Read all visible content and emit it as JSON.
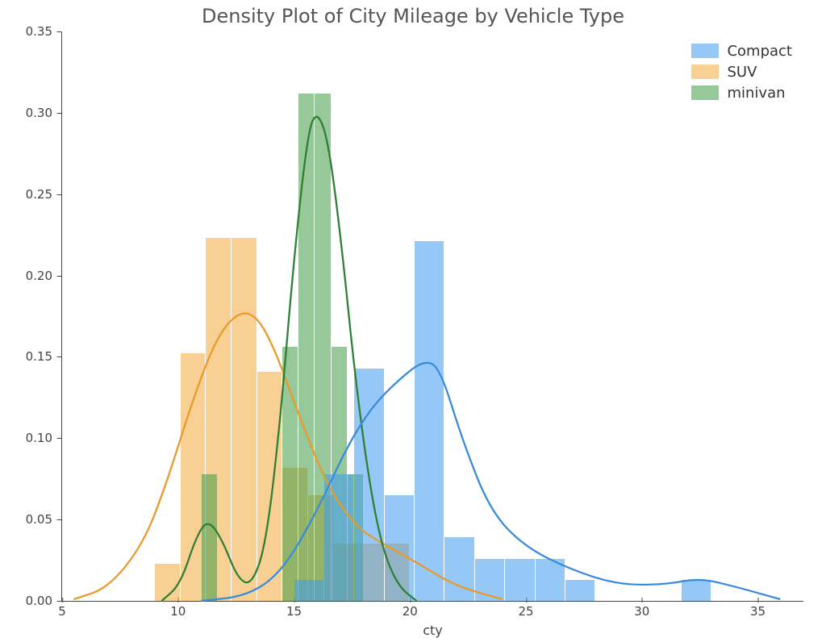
{
  "chart_data": {
    "type": "histogram+kde",
    "title": "Density Plot of City Mileage by Vehicle Type",
    "xlabel": "cty",
    "ylabel": "",
    "xlim": [
      5,
      37
    ],
    "ylim": [
      0,
      0.35
    ],
    "xticks": [
      5,
      10,
      15,
      20,
      25,
      30,
      35
    ],
    "yticks": [
      0.0,
      0.05,
      0.1,
      0.15,
      0.2,
      0.25,
      0.3,
      0.35
    ],
    "colors": {
      "Compact": "#3e9bf0",
      "SUV": "#f2a93b",
      "minivan": "#3f9b47"
    },
    "legend": [
      "Compact",
      "SUV",
      "minivan"
    ],
    "series": [
      {
        "name": "Compact",
        "bars": [
          {
            "x0": 15.0,
            "x1": 16.3,
            "y": 0.013
          },
          {
            "x0": 16.3,
            "x1": 17.6,
            "y": 0.078
          },
          {
            "x0": 17.6,
            "x1": 18.9,
            "y": 0.143
          },
          {
            "x0": 18.9,
            "x1": 20.2,
            "y": 0.065
          },
          {
            "x0": 20.2,
            "x1": 21.5,
            "y": 0.221
          },
          {
            "x0": 21.5,
            "x1": 22.8,
            "y": 0.039
          },
          {
            "x0": 22.8,
            "x1": 24.1,
            "y": 0.026
          },
          {
            "x0": 24.1,
            "x1": 25.4,
            "y": 0.026
          },
          {
            "x0": 25.4,
            "x1": 26.7,
            "y": 0.026
          },
          {
            "x0": 26.7,
            "x1": 28.0,
            "y": 0.013
          },
          {
            "x0": 31.7,
            "x1": 33.0,
            "y": 0.013
          }
        ],
        "kde": [
          {
            "x": 11.0,
            "y": 0.0
          },
          {
            "x": 13.0,
            "y": 0.003
          },
          {
            "x": 14.5,
            "y": 0.018
          },
          {
            "x": 16.0,
            "y": 0.055
          },
          {
            "x": 17.3,
            "y": 0.095
          },
          {
            "x": 18.4,
            "y": 0.12
          },
          {
            "x": 19.6,
            "y": 0.137
          },
          {
            "x": 20.6,
            "y": 0.148
          },
          {
            "x": 21.3,
            "y": 0.144
          },
          {
            "x": 22.3,
            "y": 0.098
          },
          {
            "x": 23.5,
            "y": 0.055
          },
          {
            "x": 25.0,
            "y": 0.033
          },
          {
            "x": 27.0,
            "y": 0.019
          },
          {
            "x": 29.0,
            "y": 0.01
          },
          {
            "x": 31.0,
            "y": 0.01
          },
          {
            "x": 32.5,
            "y": 0.014
          },
          {
            "x": 34.0,
            "y": 0.009
          },
          {
            "x": 36.0,
            "y": 0.001
          }
        ]
      },
      {
        "name": "SUV",
        "bars": [
          {
            "x0": 9.0,
            "x1": 10.1,
            "y": 0.023
          },
          {
            "x0": 10.1,
            "x1": 11.2,
            "y": 0.152
          },
          {
            "x0": 11.2,
            "x1": 12.3,
            "y": 0.223
          },
          {
            "x0": 12.3,
            "x1": 13.4,
            "y": 0.223
          },
          {
            "x0": 13.4,
            "x1": 14.5,
            "y": 0.141
          },
          {
            "x0": 14.5,
            "x1": 15.6,
            "y": 0.082
          },
          {
            "x0": 15.6,
            "x1": 16.7,
            "y": 0.065
          },
          {
            "x0": 16.7,
            "x1": 17.8,
            "y": 0.035
          },
          {
            "x0": 17.8,
            "x1": 18.9,
            "y": 0.035
          },
          {
            "x0": 18.9,
            "x1": 20.0,
            "y": 0.035
          }
        ],
        "kde": [
          {
            "x": 5.5,
            "y": 0.001
          },
          {
            "x": 7.0,
            "y": 0.008
          },
          {
            "x": 8.5,
            "y": 0.035
          },
          {
            "x": 9.5,
            "y": 0.072
          },
          {
            "x": 10.6,
            "y": 0.122
          },
          {
            "x": 11.6,
            "y": 0.16
          },
          {
            "x": 12.5,
            "y": 0.177
          },
          {
            "x": 13.3,
            "y": 0.177
          },
          {
            "x": 14.1,
            "y": 0.158
          },
          {
            "x": 15.2,
            "y": 0.115
          },
          {
            "x": 16.4,
            "y": 0.072
          },
          {
            "x": 17.7,
            "y": 0.045
          },
          {
            "x": 19.0,
            "y": 0.034
          },
          {
            "x": 20.5,
            "y": 0.022
          },
          {
            "x": 22.0,
            "y": 0.009
          },
          {
            "x": 24.0,
            "y": 0.001
          }
        ]
      },
      {
        "name": "minivan",
        "bars": [
          {
            "x0": 11.0,
            "x1": 11.7,
            "y": 0.078
          },
          {
            "x0": 14.5,
            "x1": 15.2,
            "y": 0.156
          },
          {
            "x0": 15.2,
            "x1": 15.9,
            "y": 0.312
          },
          {
            "x0": 15.9,
            "x1": 16.6,
            "y": 0.312
          },
          {
            "x0": 16.6,
            "x1": 17.3,
            "y": 0.156
          },
          {
            "x0": 17.3,
            "x1": 18.0,
            "y": 0.078
          }
        ],
        "kde": [
          {
            "x": 9.3,
            "y": 0.0
          },
          {
            "x": 10.1,
            "y": 0.01
          },
          {
            "x": 10.8,
            "y": 0.04
          },
          {
            "x": 11.3,
            "y": 0.05
          },
          {
            "x": 11.9,
            "y": 0.038
          },
          {
            "x": 12.6,
            "y": 0.013
          },
          {
            "x": 13.2,
            "y": 0.01
          },
          {
            "x": 13.8,
            "y": 0.035
          },
          {
            "x": 14.4,
            "y": 0.108
          },
          {
            "x": 15.0,
            "y": 0.21
          },
          {
            "x": 15.6,
            "y": 0.288
          },
          {
            "x": 16.0,
            "y": 0.302
          },
          {
            "x": 16.5,
            "y": 0.283
          },
          {
            "x": 17.1,
            "y": 0.215
          },
          {
            "x": 17.6,
            "y": 0.144
          },
          {
            "x": 18.2,
            "y": 0.078
          },
          {
            "x": 18.8,
            "y": 0.033
          },
          {
            "x": 19.5,
            "y": 0.009
          },
          {
            "x": 20.3,
            "y": 0.0
          }
        ]
      }
    ]
  }
}
